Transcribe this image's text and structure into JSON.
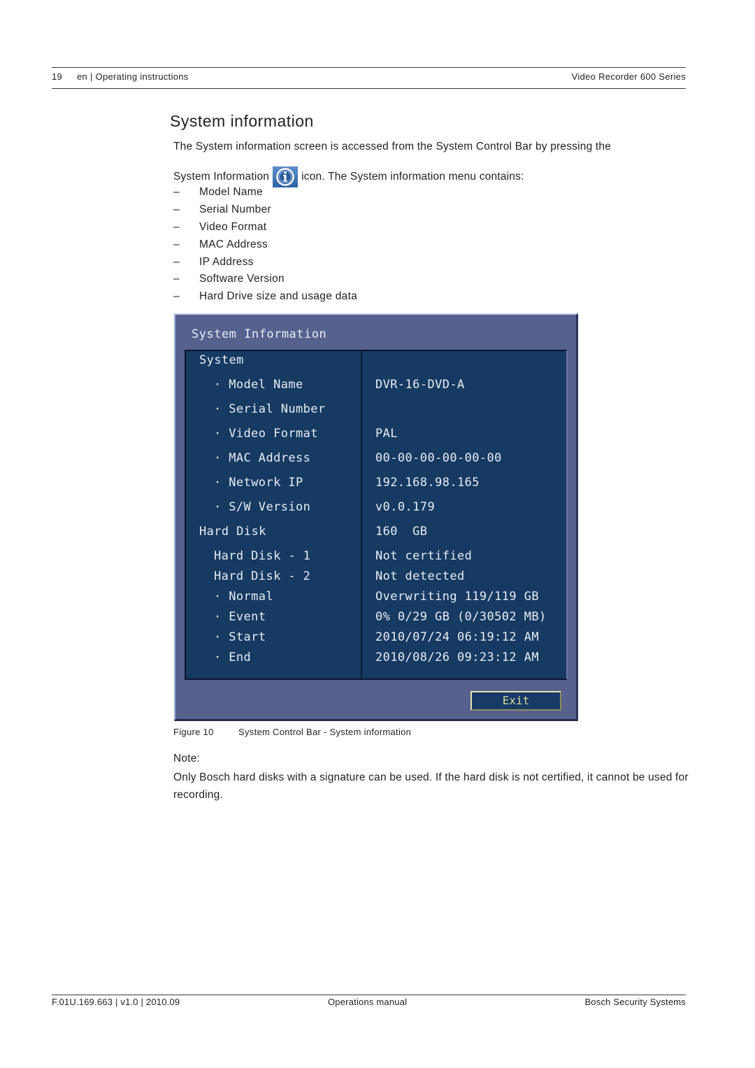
{
  "header": {
    "page_number": "19",
    "section": "en | Operating instructions",
    "product": "Video Recorder 600 Series"
  },
  "title": "System information",
  "intro": {
    "line1": "The System information screen is accessed from the System Control Bar by pressing the",
    "line2_before_icon": "System Information",
    "icon": "info-icon",
    "line2_after_icon": "icon. The System information menu contains:"
  },
  "menu_contents": [
    {
      "bullet": "–",
      "label": "Model Name"
    },
    {
      "bullet": "–",
      "label": "Serial Number"
    },
    {
      "bullet": "–",
      "label": "Video Format"
    },
    {
      "bullet": "–",
      "label": "MAC Address"
    },
    {
      "bullet": "–",
      "label": "IP Address"
    },
    {
      "bullet": "–",
      "label": "Software Version"
    },
    {
      "bullet": "–",
      "label": "Hard Drive size and usage data"
    }
  ],
  "dvr_screen": {
    "title": "System Information",
    "colors": {
      "frame": "#56618e",
      "table_bg": "#163a62",
      "text": "#e8ecf4",
      "exit_text": "#d8dc9a",
      "exit_border": "#e6e2b0"
    },
    "rows": [
      {
        "label": "System",
        "value": ""
      },
      {
        "label": "· Model Name",
        "value": "DVR-16-DVD-A"
      },
      {
        "label": "· Serial Number",
        "value": ""
      },
      {
        "label": "· Video Format",
        "value": "PAL"
      },
      {
        "label": "· MAC Address",
        "value": "00-00-00-00-00-00"
      },
      {
        "label": "· Network IP",
        "value": "192.168.98.165"
      },
      {
        "label": "· S/W Version",
        "value": "v0.0.179"
      },
      {
        "label": "Hard Disk",
        "value": "160  GB"
      },
      {
        "label": "Hard Disk - 1",
        "value": "Not certified"
      },
      {
        "label": "Hard Disk - 2",
        "value": "Not detected"
      },
      {
        "label": "· Normal",
        "value": "Overwriting 119/119 GB"
      },
      {
        "label": "· Event",
        "value": "0% 0/29 GB (0/30502 MB)"
      },
      {
        "label": "· Start",
        "value": "2010/07/24 06:19:12 AM"
      },
      {
        "label": "· End",
        "value": "2010/08/26 09:23:12 AM"
      }
    ],
    "exit_label": "Exit"
  },
  "figure": {
    "number": "Figure  10",
    "caption": "System Control Bar - System information"
  },
  "note": {
    "label": "Note:",
    "text": "Only Bosch hard disks with a signature can be used. If the hard disk is not certified, it cannot be used for recording."
  },
  "footer": {
    "doc_id": "F.01U.169.663 | v1.0 | 2010.09",
    "doc_type": "Operations manual",
    "company": "Bosch Security Systems"
  }
}
